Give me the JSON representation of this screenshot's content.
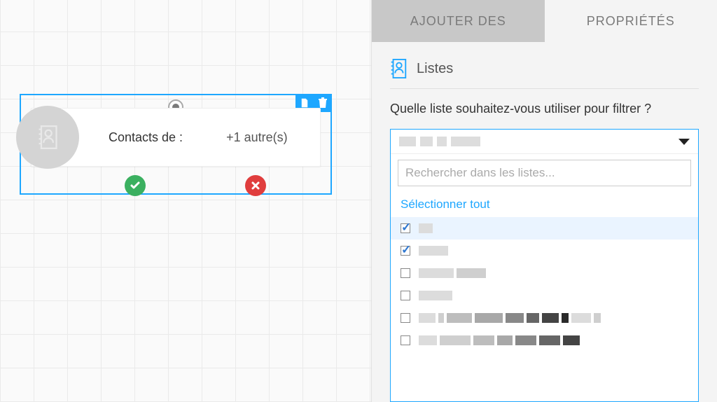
{
  "tabs": {
    "add_label": "AJOUTER DES",
    "props_label": "PROPRIÉTÉS"
  },
  "section": {
    "title": "Listes",
    "prompt": "Quelle liste souhaitez-vous utiliser pour filtrer ?"
  },
  "node": {
    "label_a": "Contacts de :",
    "label_b": "+1 autre(s)"
  },
  "dropdown": {
    "search_placeholder": "Rechercher dans les listes...",
    "select_all": "Sélectionner tout",
    "items": [
      {
        "checked": true,
        "highlight": true,
        "blocks": [
          20
        ]
      },
      {
        "checked": true,
        "highlight": false,
        "blocks": [
          42
        ]
      },
      {
        "checked": false,
        "highlight": false,
        "blocks": [
          50,
          42
        ]
      },
      {
        "checked": false,
        "highlight": false,
        "blocks": [
          48
        ]
      },
      {
        "checked": false,
        "highlight": false,
        "blocks": [
          24,
          8,
          36,
          40,
          26,
          18,
          24,
          10,
          28,
          10
        ]
      },
      {
        "checked": false,
        "highlight": false,
        "blocks": [
          26,
          44,
          30,
          22,
          30,
          30,
          24
        ]
      }
    ]
  }
}
